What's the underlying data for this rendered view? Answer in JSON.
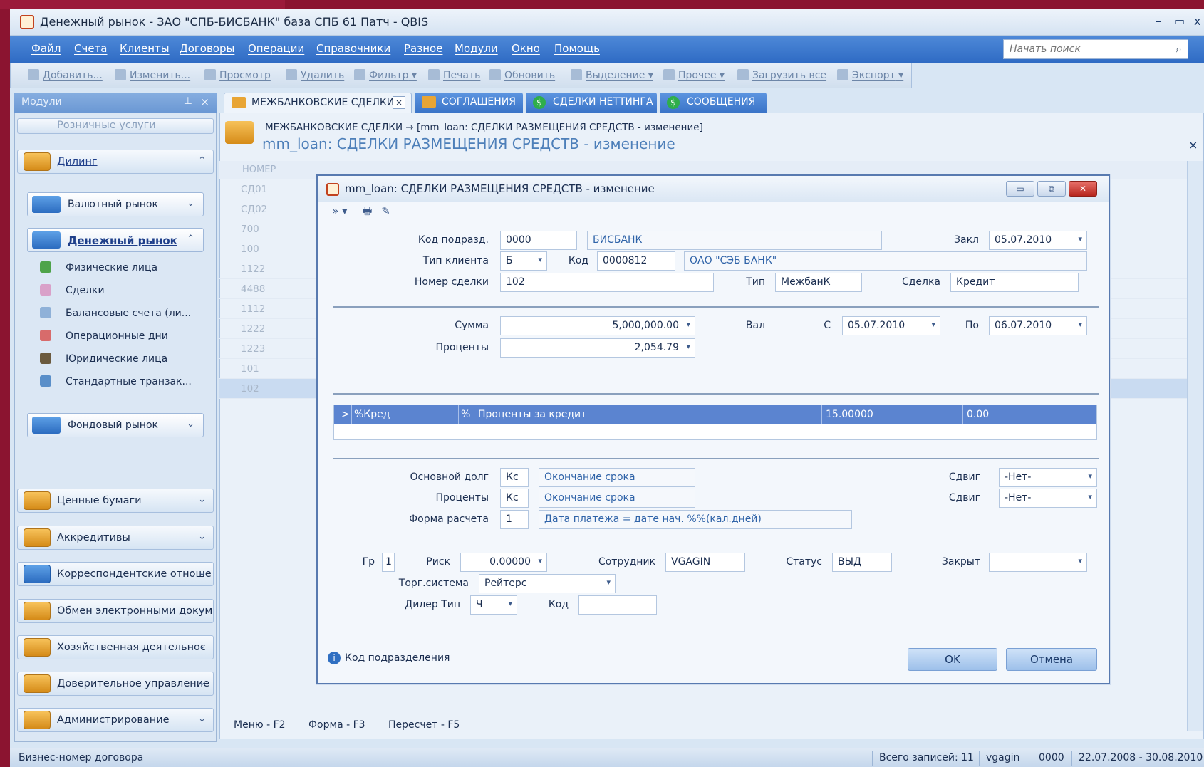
{
  "app": {
    "title": "Денежный рынок - ЗАО \"СПБ-БИСБАНК\" база СПБ 61 Патч - QBIS"
  },
  "menu": [
    "Файл",
    "Счета",
    "Клиенты",
    "Договоры",
    "Операции",
    "Справочники",
    "Разное",
    "Модули",
    "Окно",
    "Помощь"
  ],
  "search": {
    "placeholder": "Начать поиск"
  },
  "toolbar": [
    "Добавить...",
    "Изменить...",
    "Просмотр",
    "Удалить",
    "Фильтр",
    "Печать",
    "Обновить",
    "Выделение",
    "Прочее",
    "Загрузить все",
    "Экспорт"
  ],
  "modules": {
    "header": "Модули",
    "top_group": "Розничные услуги",
    "dealing": "Дилинг",
    "fx_market": "Валютный рынок",
    "money_market": "Денежный рынок",
    "money_items": [
      "Физические лица",
      "Сделки",
      "Балансовые счета (ли...",
      "Операционные дни",
      "Юридические лица",
      "Стандартные транзак..."
    ],
    "stock_market": "Фондовый рынок",
    "groups": [
      "Ценные бумаги",
      "Аккредитивы",
      "Корреспондентские отноше",
      "Обмен электронными докум",
      "Хозяйственная деятельнос",
      "Доверительное управление",
      "Администрирование"
    ]
  },
  "tabs": [
    "МЕЖБАНКОВСКИЕ СДЕЛКИ",
    "СОГЛАШЕНИЯ",
    "СДЕЛКИ НЕТТИНГА",
    "СООБЩЕНИЯ"
  ],
  "content": {
    "breadcrumb": "МЕЖБАНКОВСКИЕ СДЕЛКИ → [mm_loan: СДЕЛКИ РАЗМЕЩЕНИЯ СРЕДСТВ - изменение]",
    "title": "mm_loan: СДЕЛКИ РАЗМЕЩЕНИЯ СРЕДСТВ - изменение",
    "bg_header": "НОМЕР",
    "bg_rows": [
      "СД01",
      "СД02",
      "700",
      "100",
      "1122",
      "4488",
      "1112",
      "1222",
      "1223",
      "101",
      "102"
    ]
  },
  "dialog": {
    "title": "mm_loan: СДЕЛКИ РАЗМЕЩЕНИЯ СРЕДСТВ - изменение",
    "labels": {
      "dept_code": "Код подразд.",
      "client_type": "Тип клиента",
      "code": "Код",
      "deal_no": "Номер сделки",
      "concluded": "Закл",
      "type": "Тип",
      "deal": "Сделка",
      "sum": "Сумма",
      "interest": "Проценты",
      "currency": "Вал",
      "from": "С",
      "to": "По",
      "principal": "Основной долг",
      "interest2": "Проценты",
      "settlement": "Форма расчета",
      "shift1": "Сдвиг",
      "shift2": "Сдвиг",
      "gr": "Гр",
      "risk": "Риск",
      "employee": "Сотрудник",
      "status": "Статус",
      "closed": "Закрыт",
      "trade_system": "Торг.система",
      "dealer_type": "Дилер Тип",
      "code2": "Код"
    },
    "values": {
      "dept_code": "0000",
      "dept_name": "БИСБАНК",
      "concluded": "05.07.2010",
      "client_type": "Б",
      "client_code": "0000812",
      "client_name": "ОАО \"СЭБ БАНК\"",
      "deal_no": "102",
      "type": "МежбанК",
      "deal": "Кредит",
      "sum": "5,000,000.00",
      "interest": "2,054.79",
      "from": "05.07.2010",
      "to": "06.07.2010",
      "principal_code": "Кс",
      "principal_desc": "Окончание срока",
      "interest_code": "Кс",
      "interest_desc": "Окончание срока",
      "settlement_code": "1",
      "settlement_desc": "Дата платежа = дате нач. %%(кал.дней)",
      "shift1": "-Нет-",
      "shift2": "-Нет-",
      "gr": "1",
      "risk": "0.00000",
      "employee": "VGAGIN",
      "status": "ВЫД",
      "closed": "",
      "trade_system": "Рейтерс",
      "dealer_type": "Ч",
      "code2": ""
    },
    "rate_row": {
      "arrow": ">",
      "code": "%Кред",
      "pct": "%",
      "desc": "Проценты за кредит",
      "rate": "15.00000",
      "extra": "0.00"
    },
    "hint": "Код подразделения",
    "ok": "OK",
    "cancel": "Отмена"
  },
  "fkeys": [
    "Меню - F2",
    "Форма - F3",
    "Пересчет - F5"
  ],
  "status": {
    "left": "Бизнес-номер договора",
    "records": "Всего записей: 11",
    "user": "vgagin",
    "code": "0000",
    "period": "22.07.2008 - 30.08.2010"
  }
}
